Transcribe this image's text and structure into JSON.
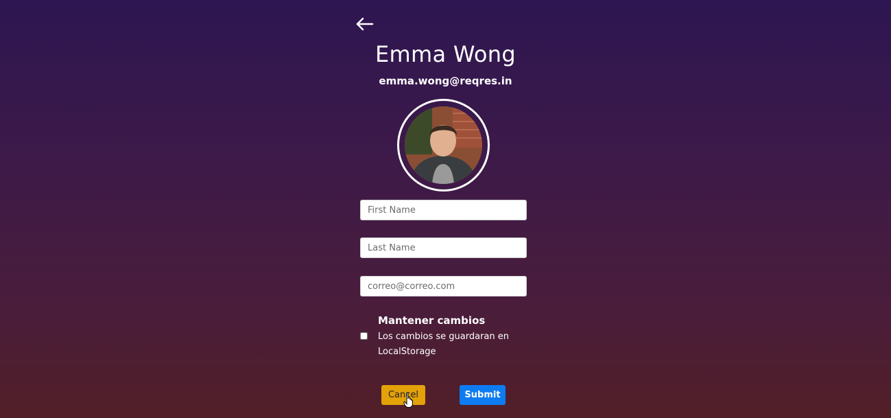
{
  "header": {
    "back_icon": "arrow-left-icon"
  },
  "profile": {
    "name": "Emma Wong",
    "email": "emma.wong@reqres.in",
    "avatar_icon": "user-avatar-photo"
  },
  "form": {
    "first_name": {
      "placeholder": "First Name",
      "value": ""
    },
    "last_name": {
      "placeholder": "Last Name",
      "value": ""
    },
    "email": {
      "placeholder": "correo@correo.com",
      "value": ""
    },
    "keep_changes": {
      "title": "Mantener cambios",
      "description": "Los cambios se guardaran en LocalStorage",
      "checked": false
    }
  },
  "actions": {
    "cancel_label": "Cancel",
    "submit_label": "Submit"
  },
  "colors": {
    "cancel": "#e3a208",
    "submit": "#0d7cf2"
  }
}
